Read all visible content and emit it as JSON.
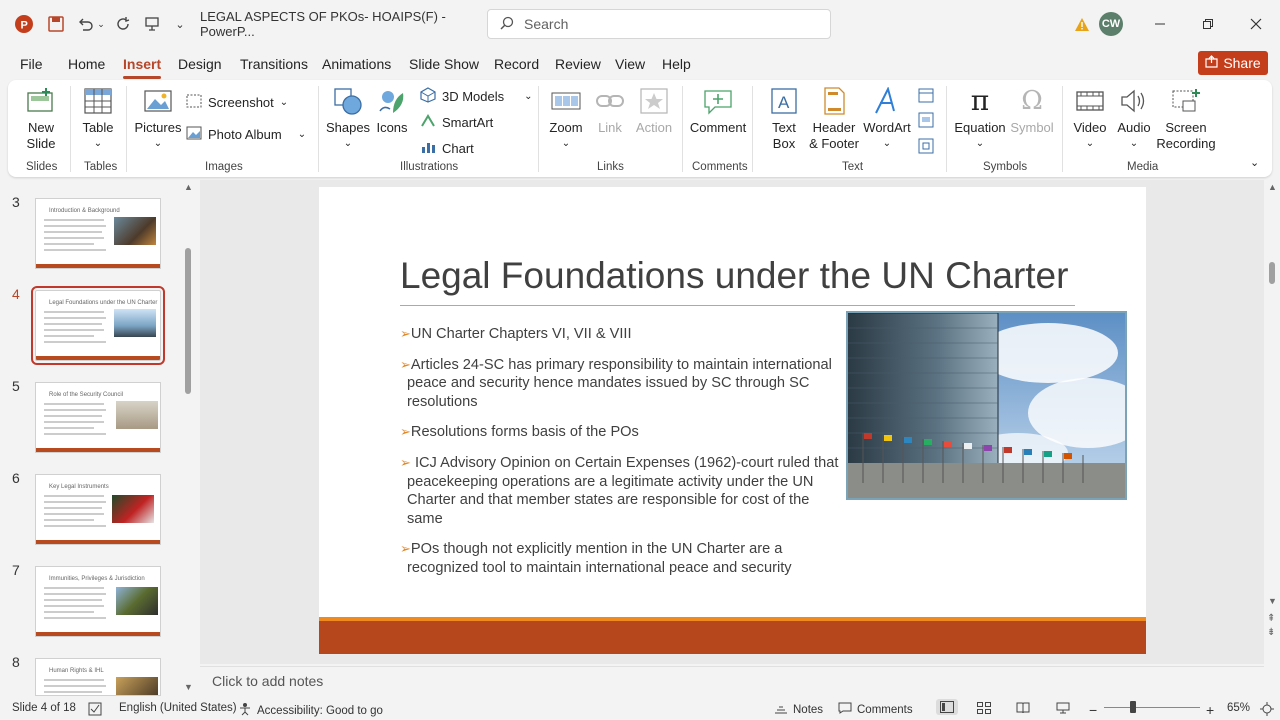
{
  "titlebar": {
    "doc_title": "LEGAL ASPECTS OF PKOs- HOAIPS(F)  -  PowerP...",
    "search_placeholder": "Search",
    "avatar_initials": "CW"
  },
  "menu": {
    "items": [
      "File",
      "Home",
      "Insert",
      "Design",
      "Transitions",
      "Animations",
      "Slide Show",
      "Record",
      "Review",
      "View",
      "Help"
    ],
    "active": "Insert",
    "share_label": "Share"
  },
  "ribbon": {
    "new_slide": "New Slide",
    "table": "Table",
    "pictures": "Pictures",
    "screenshot": "Screenshot",
    "photo_album": "Photo Album",
    "shapes": "Shapes",
    "icons": "Icons",
    "models_3d": "3D Models",
    "smartart": "SmartArt",
    "chart": "Chart",
    "zoom": "Zoom",
    "link": "Link",
    "action": "Action",
    "comment": "Comment",
    "text_box": "Text Box",
    "header_footer": "Header & Footer",
    "wordart": "WordArt",
    "equation": "Equation",
    "symbol": "Symbol",
    "video": "Video",
    "audio": "Audio",
    "screen_recording": "Screen Recording",
    "groups": {
      "slides": "Slides",
      "tables": "Tables",
      "images": "Images",
      "illustrations": "Illustrations",
      "links": "Links",
      "comments": "Comments",
      "text": "Text",
      "symbols": "Symbols",
      "media": "Media"
    }
  },
  "thumbnails": [
    {
      "num": "3",
      "title": "Introduction & Background"
    },
    {
      "num": "4",
      "title": "Legal Foundations under the UN Charter"
    },
    {
      "num": "5",
      "title": "Role of the Security Council"
    },
    {
      "num": "6",
      "title": "Key Legal Instruments"
    },
    {
      "num": "7",
      "title": "Immunities, Privileges & Jurisdiction"
    },
    {
      "num": "8",
      "title": "Human Rights & IHL"
    }
  ],
  "slide": {
    "title": "Legal Foundations under the UN Charter",
    "bullets": [
      "UN Charter Chapters VI, VII & VIII",
      "Articles 24-SC has primary responsibility to maintain international   peace and security hence mandates issued by SC through SC resolutions",
      "Resolutions forms basis of the POs",
      " ICJ Advisory Opinion on Certain Expenses (1962)-court ruled that peacekeeping operations are a legitimate activity under the UN Charter and that member states are responsible for cost of the same",
      "POs though not explicitly mention in the UN Charter are a recognized tool to maintain international  peace and security"
    ]
  },
  "notes_placeholder": "Click to add notes",
  "status": {
    "slide_counter": "Slide 4 of 18",
    "language": "English (United States)",
    "accessibility": "Accessibility: Good to go",
    "notes": "Notes",
    "comments": "Comments",
    "zoom": "65%"
  },
  "colors": {
    "accent": "#b7472a",
    "share": "#c43e1c",
    "slide_footer": "#b6461c",
    "slide_footer_line": "#f08a1e",
    "bullet_arrow": "#e0882c"
  }
}
